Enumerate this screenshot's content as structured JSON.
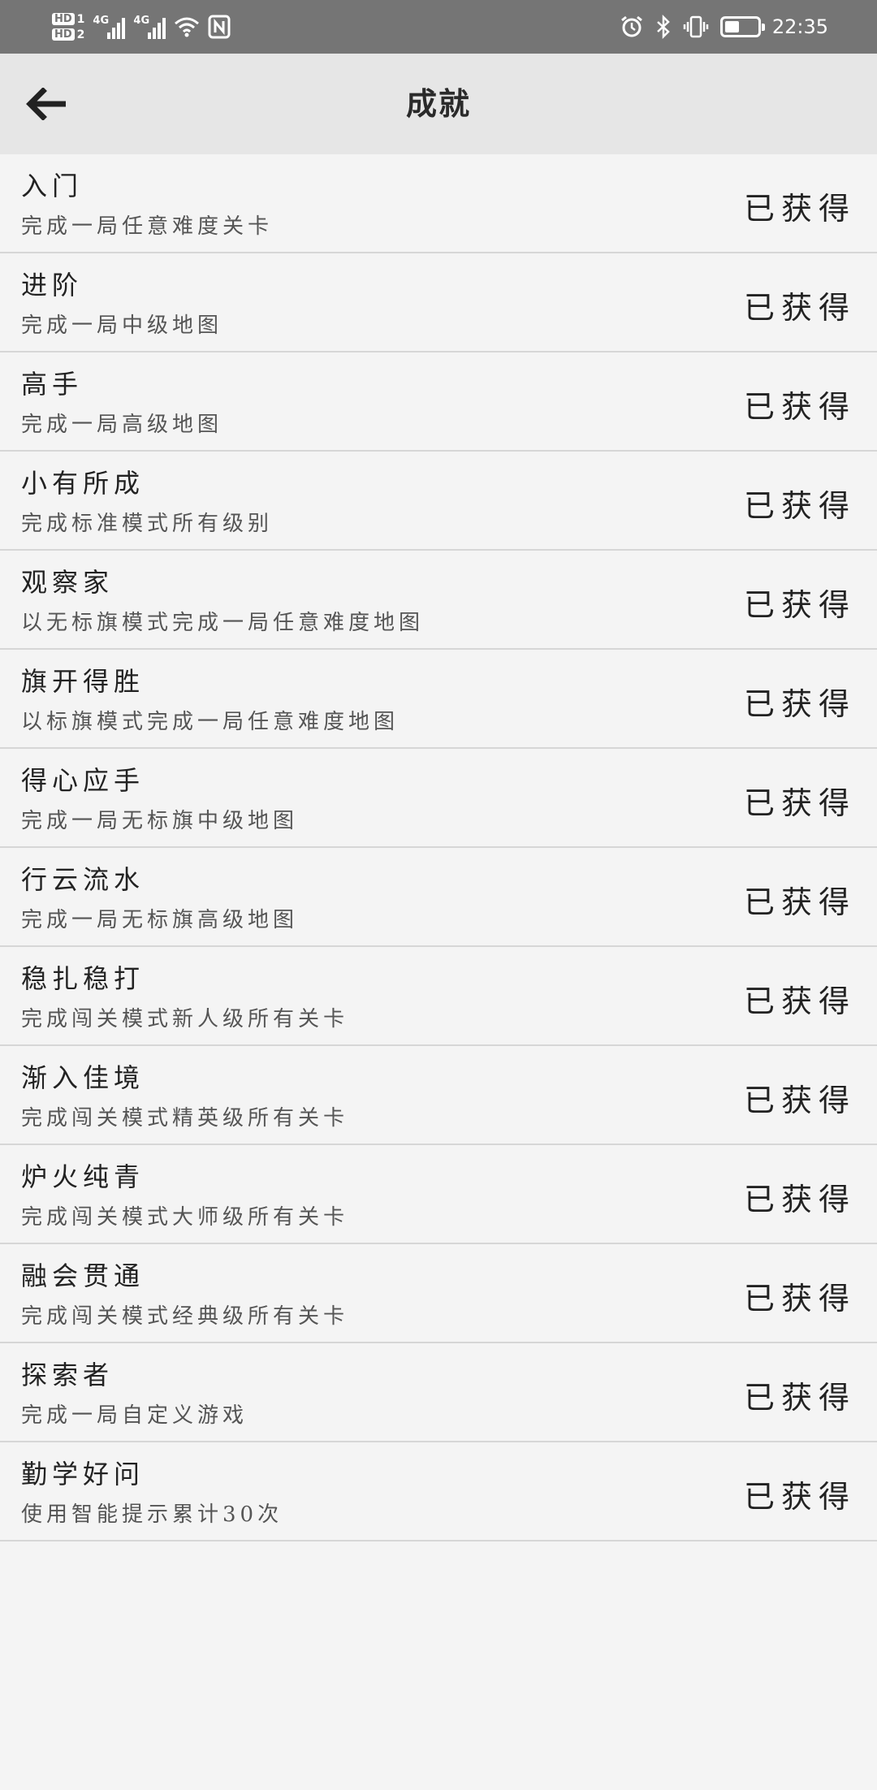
{
  "status_bar": {
    "hd1": "HD",
    "hd1_num": "1",
    "hd2": "HD",
    "hd2_num": "2",
    "net1": "4G",
    "net2": "4G",
    "time": "22:35",
    "battery_level": 0.45
  },
  "header": {
    "title": "成就"
  },
  "achievements": [
    {
      "title": "入门",
      "description": "完成一局任意难度关卡",
      "status": "已获得"
    },
    {
      "title": "进阶",
      "description": "完成一局中级地图",
      "status": "已获得"
    },
    {
      "title": "高手",
      "description": "完成一局高级地图",
      "status": "已获得"
    },
    {
      "title": "小有所成",
      "description": "完成标准模式所有级别",
      "status": "已获得"
    },
    {
      "title": "观察家",
      "description": "以无标旗模式完成一局任意难度地图",
      "status": "已获得"
    },
    {
      "title": "旗开得胜",
      "description": "以标旗模式完成一局任意难度地图",
      "status": "已获得"
    },
    {
      "title": "得心应手",
      "description": "完成一局无标旗中级地图",
      "status": "已获得"
    },
    {
      "title": "行云流水",
      "description": "完成一局无标旗高级地图",
      "status": "已获得"
    },
    {
      "title": "稳扎稳打",
      "description": "完成闯关模式新人级所有关卡",
      "status": "已获得"
    },
    {
      "title": "渐入佳境",
      "description": "完成闯关模式精英级所有关卡",
      "status": "已获得"
    },
    {
      "title": "炉火纯青",
      "description": "完成闯关模式大师级所有关卡",
      "status": "已获得"
    },
    {
      "title": "融会贯通",
      "description": "完成闯关模式经典级所有关卡",
      "status": "已获得"
    },
    {
      "title": "探索者",
      "description": "完成一局自定义游戏",
      "status": "已获得"
    },
    {
      "title": "勤学好问",
      "description": "使用智能提示累计30次",
      "status": "已获得"
    }
  ]
}
